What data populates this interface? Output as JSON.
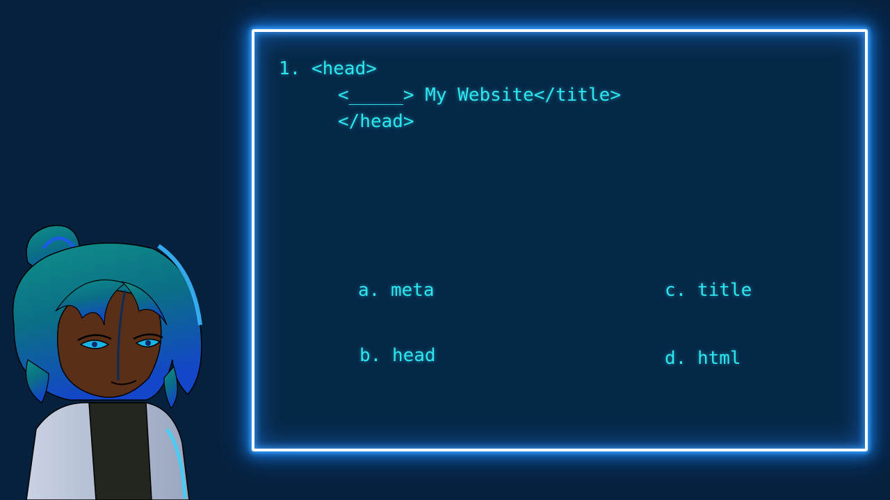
{
  "question": {
    "line1": "1. <head>",
    "line2": "<_____> My Website</title>",
    "line3": "</head>"
  },
  "options": {
    "a": "a. meta",
    "b": "b. head",
    "c": "c. title",
    "d": "d. html"
  },
  "colors": {
    "background": "#06213d",
    "panel": "#062847",
    "text": "#2ee6f2",
    "glow": "#1e90ff",
    "frame": "#ffffff"
  },
  "icons": {
    "character": "character-portrait-icon"
  }
}
